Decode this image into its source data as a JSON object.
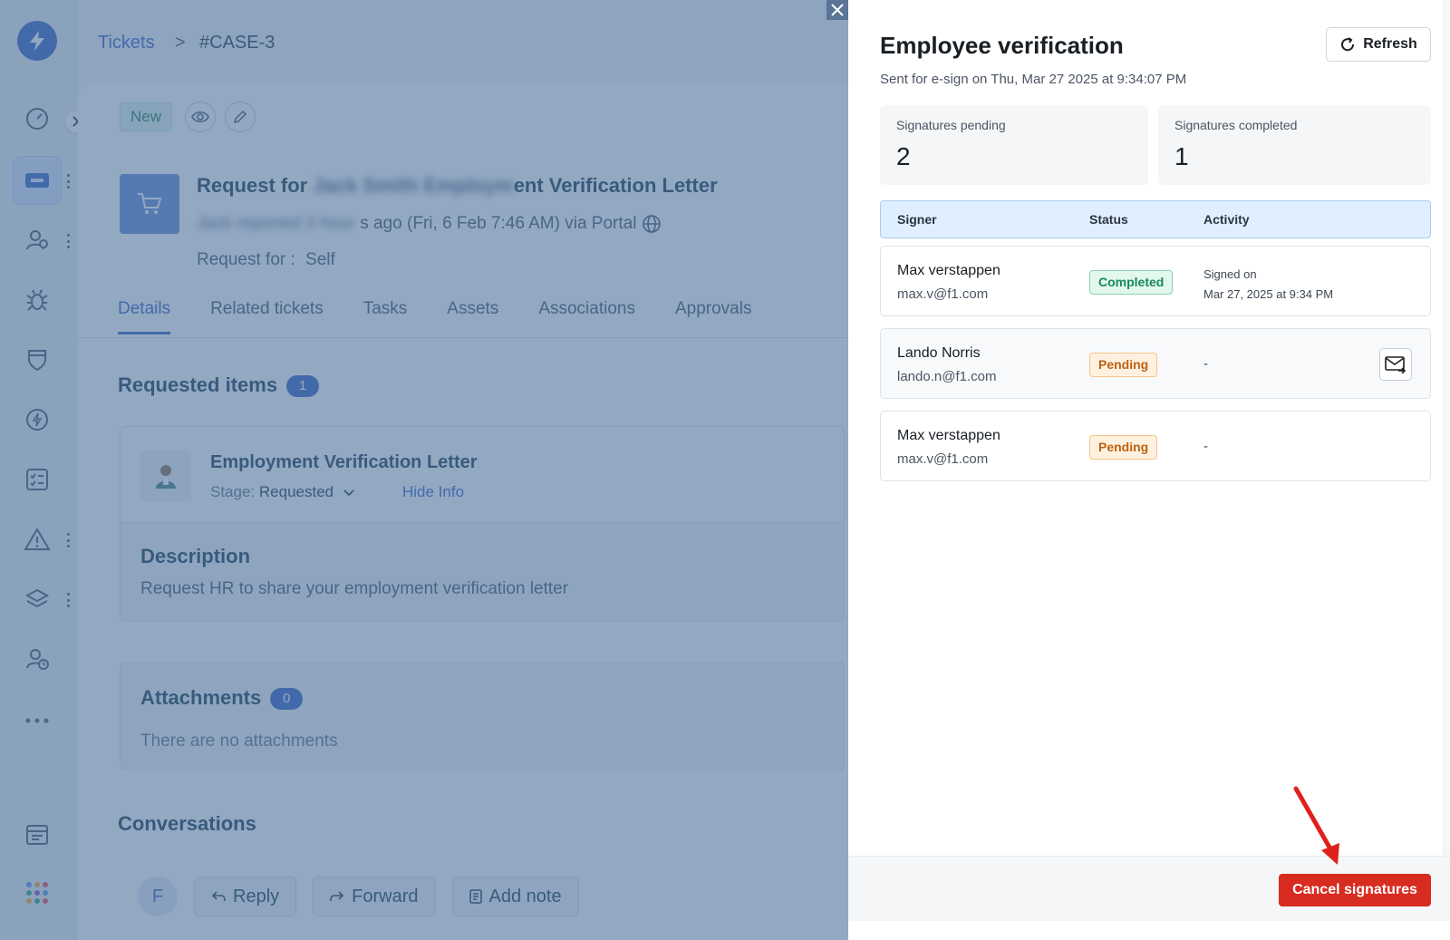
{
  "breadcrumb": {
    "root": "Tickets",
    "separator": ">",
    "current": "#CASE-3"
  },
  "ticket": {
    "status": "New",
    "title_visible_start": "Request for",
    "title_redacted": "Jack Smith Employm",
    "title_visible_end": "ent Verification Letter",
    "meta_redacted": "Jack reported 3 hour",
    "meta_visible": "s ago (Fri, 6 Feb 7:46 AM) via Portal",
    "request_for_label": "Request for :",
    "request_for_value": "Self"
  },
  "tabs": [
    "Details",
    "Related tickets",
    "Tasks",
    "Assets",
    "Associations",
    "Approvals"
  ],
  "requested_items": {
    "title": "Requested items",
    "count": "1",
    "item_name": "Employment Verification Letter",
    "stage_label": "Stage:",
    "stage_value": "Requested",
    "hide_info": "Hide Info",
    "description_title": "Description",
    "description_text": "Request HR to share your employment verification letter"
  },
  "attachments": {
    "title": "Attachments",
    "count": "0",
    "empty_text": "There are no attachments"
  },
  "conversations": {
    "title": "Conversations",
    "avatar_initial": "F",
    "reply": "Reply",
    "forward": "Forward",
    "add_note": "Add note"
  },
  "panel": {
    "title": "Employee verification",
    "subtitle": "Sent for e-sign on Thu, Mar 27 2025 at 9:34:07 PM",
    "refresh_label": "Refresh",
    "stats": {
      "pending_label": "Signatures pending",
      "pending_value": "2",
      "completed_label": "Signatures completed",
      "completed_value": "1"
    },
    "table_headers": {
      "signer": "Signer",
      "status": "Status",
      "activity": "Activity"
    },
    "rows": [
      {
        "name": "Max verstappen",
        "email": "max.v@f1.com",
        "status": "Completed",
        "activity_line1": "Signed on",
        "activity_line2": "Mar 27, 2025 at 9:34 PM"
      },
      {
        "name": "Lando Norris",
        "email": "lando.n@f1.com",
        "status": "Pending",
        "activity_line1": "-"
      },
      {
        "name": "Max verstappen",
        "email": "max.v@f1.com",
        "status": "Pending",
        "activity_line1": "-"
      }
    ],
    "cancel_label": "Cancel signatures"
  },
  "colors": {
    "brand": "#2c5cc5",
    "cancel": "#d82c20",
    "completed": "#188a5a",
    "pending": "#bd6210",
    "annotation_arrow": "#e0201b"
  },
  "icons": {
    "logo": "lightning-icon",
    "refresh": "refresh-icon",
    "resend": "mail-forward-icon"
  }
}
